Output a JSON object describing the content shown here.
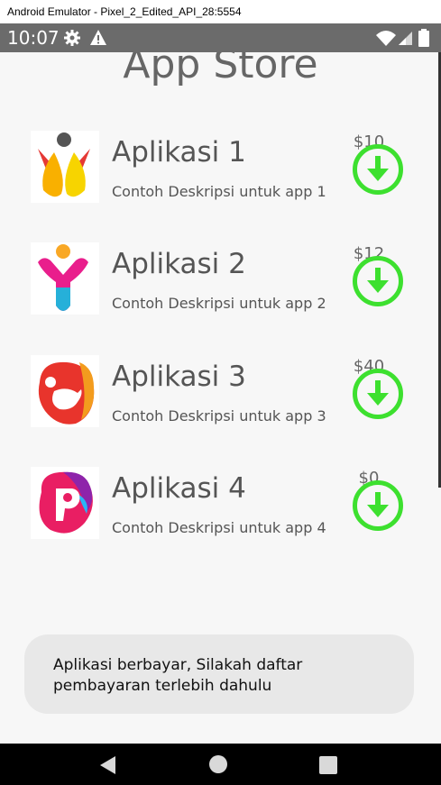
{
  "window": {
    "title": "Android Emulator - Pixel_2_Edited_API_28:5554"
  },
  "statusbar": {
    "time": "10:07",
    "left_icons": [
      "gear-icon",
      "warning-icon"
    ],
    "right_icons": [
      "wifi-icon",
      "signal-icon",
      "battery-icon"
    ]
  },
  "app": {
    "title": "App Store",
    "items": [
      {
        "name": "Aplikasi 1",
        "description": "Contoh Deskripsi untuk app 1",
        "price": "$10",
        "icon": "app-logo-icon"
      },
      {
        "name": "Aplikasi 2",
        "description": "Contoh Deskripsi untuk app 2",
        "price": "$12",
        "icon": "app-logo-icon"
      },
      {
        "name": "Aplikasi 3",
        "description": "Contoh Deskripsi untuk app 3",
        "price": "$40",
        "icon": "app-logo-icon"
      },
      {
        "name": "Aplikasi 4",
        "description": "Contoh Deskripsi untuk app 4",
        "price": "$0",
        "icon": "app-logo-icon"
      }
    ],
    "download_icon": "download-icon",
    "toast": "Aplikasi berbayar, Silakah daftar pembayaran terlebih dahulu"
  },
  "navbar": {
    "icons": [
      "back-icon",
      "home-icon",
      "recents-icon"
    ]
  },
  "colors": {
    "accent_green": "#3de02f",
    "statusbar": "#6b6b6b",
    "background": "#f7f7f7"
  }
}
